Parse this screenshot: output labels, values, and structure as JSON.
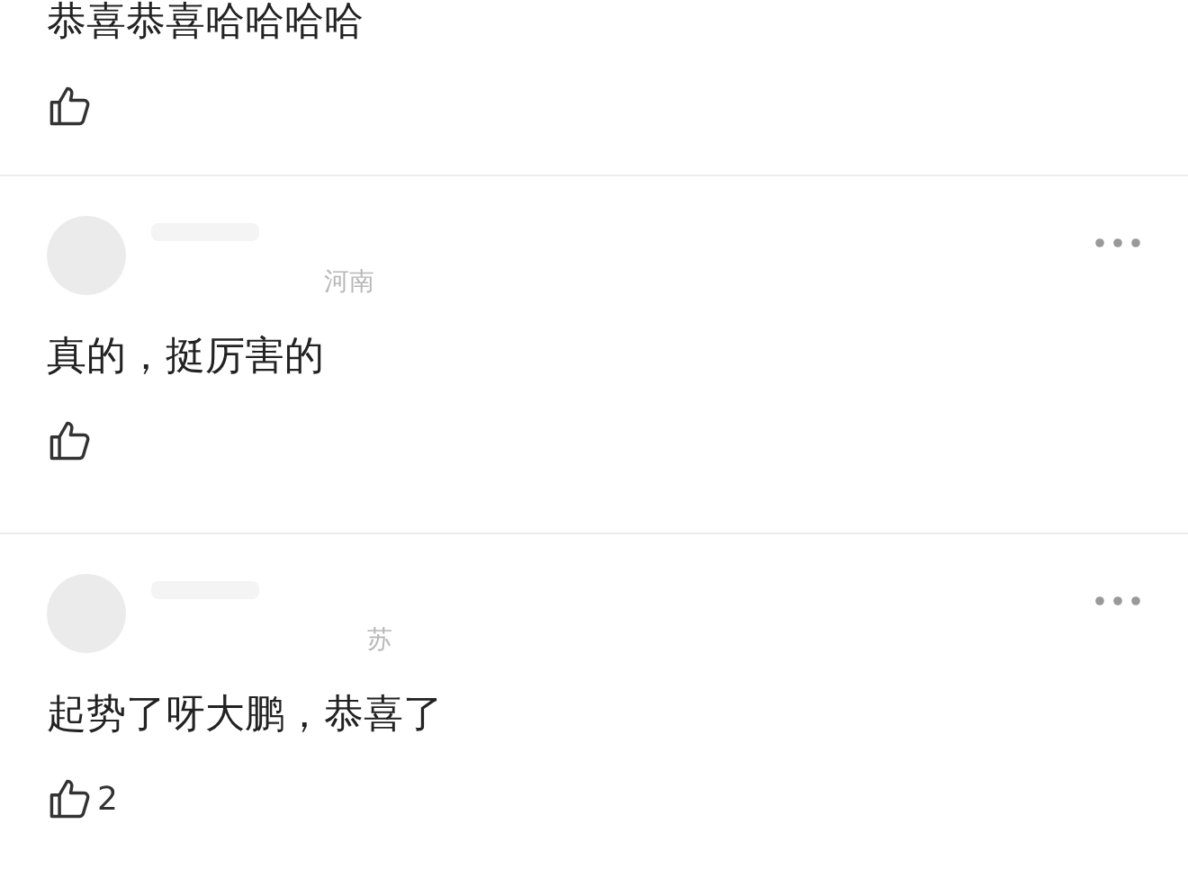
{
  "comments": [
    {
      "kind": "cut",
      "text": "恭喜恭喜哈哈哈哈"
    },
    {
      "kind": "full",
      "location": "河南",
      "text": "真的，挺厉害的"
    },
    {
      "kind": "full",
      "location": "苏",
      "text": "起势了呀大鹏，恭喜了",
      "likes": "2"
    }
  ]
}
